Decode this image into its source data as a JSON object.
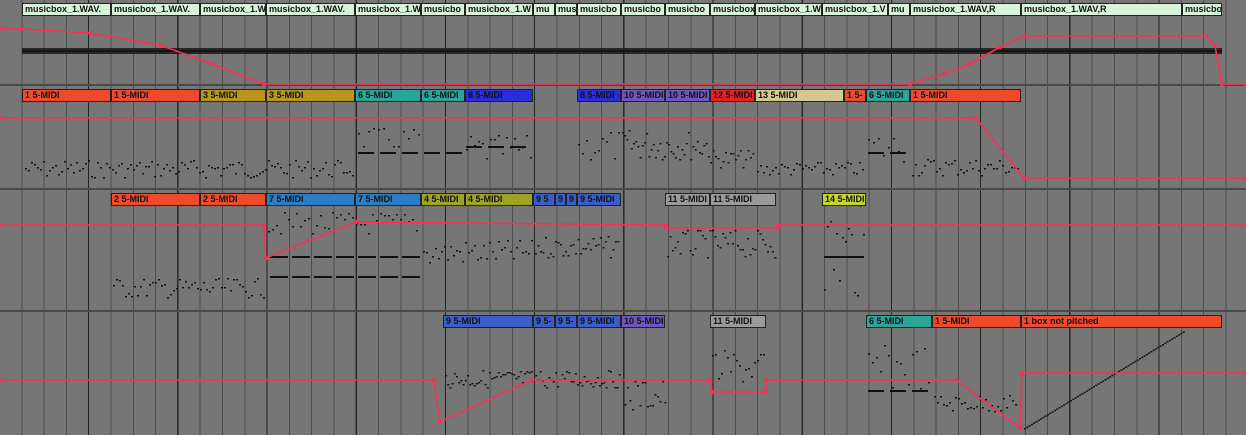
{
  "colors": {
    "automation": "#ff2d55",
    "background": "#767676",
    "note": "#111111"
  },
  "audio_clips": [
    {
      "label": "musicbox_1.WAV.",
      "color": "#d8f3d8"
    },
    {
      "label": "musicbox_1.WAV.",
      "color": "#d8f3d8"
    },
    {
      "label": "musicbox_1.W",
      "color": "#d8f3d8"
    },
    {
      "label": "musicbox_1.WAV.",
      "color": "#d8f3d8"
    },
    {
      "label": "musicbox_1.W",
      "color": "#d8f3d8"
    },
    {
      "label": "musicbo",
      "color": "#d8f3d8"
    },
    {
      "label": "musicbox_1.W",
      "color": "#d8f3d8"
    },
    {
      "label": "mu",
      "color": "#d8f3d8"
    },
    {
      "label": "mus",
      "color": "#d8f3d8"
    },
    {
      "label": "musicbo",
      "color": "#d8f3d8"
    },
    {
      "label": "musicbo",
      "color": "#d8f3d8"
    },
    {
      "label": "musicbo",
      "color": "#d8f3d8"
    },
    {
      "label": "musicbox_1.V",
      "color": "#d8f3d8"
    },
    {
      "label": "musicbox_1.W",
      "color": "#d8f3d8"
    },
    {
      "label": "musicbox_1.V",
      "color": "#d8f3d8"
    },
    {
      "label": "mu",
      "color": "#d8f3d8"
    },
    {
      "label": "musicbox_1.WAV,R",
      "color": "#d8f3d8"
    },
    {
      "label": "musicbox_1.WAV,R",
      "color": "#d8f3d8"
    },
    {
      "label": "musicbo",
      "color": "#d8f3d8"
    }
  ],
  "lane1_clips": [
    {
      "label": "1 5-MIDI",
      "color": "#f04a2a"
    },
    {
      "label": "1 5-MIDI",
      "color": "#f04a2a"
    },
    {
      "label": "3 5-MIDI",
      "color": "#b8961c"
    },
    {
      "label": "3 5-MIDI",
      "color": "#b8961c"
    },
    {
      "label": "6 5-MIDI",
      "color": "#2aa59a"
    },
    {
      "label": "6 5-MIDI",
      "color": "#2aa59a"
    },
    {
      "label": "8 5-MIDI",
      "color": "#2b2bdc"
    },
    {
      "label": "8 5-MIDI",
      "color": "#2b2bdc"
    },
    {
      "label": "10 5-MIDI",
      "color": "#6e56c2"
    },
    {
      "label": "10 5-MIDI",
      "color": "#6e56c2"
    },
    {
      "label": "12 5-MIDI",
      "color": "#ee1e1e"
    },
    {
      "label": "13 5-MIDI",
      "color": "#d4c88e"
    },
    {
      "label": "1 5-",
      "color": "#f04a2a"
    },
    {
      "label": "6 5-MIDI",
      "color": "#2aa59a"
    },
    {
      "label": "1 5-MIDI",
      "color": "#f04a2a"
    }
  ],
  "lane2_clips": [
    {
      "label": "2 5-MIDI",
      "color": "#f04a2a"
    },
    {
      "label": "2 5-MIDI",
      "color": "#f04a2a"
    },
    {
      "label": "7 5-MIDI",
      "color": "#2a7fc4"
    },
    {
      "label": "7 5-MIDI",
      "color": "#2a7fc4"
    },
    {
      "label": "4 5-MIDI",
      "color": "#9ca325"
    },
    {
      "label": "4 5-MIDI",
      "color": "#9ca325"
    },
    {
      "label": "9 5",
      "color": "#3a5ec9"
    },
    {
      "label": "9 5",
      "color": "#3a5ec9"
    },
    {
      "label": "9 5-",
      "color": "#3a5ec9"
    },
    {
      "label": "9 5-MIDI",
      "color": "#3a5ec9"
    },
    {
      "label": "11 5-MIDI",
      "color": "#9a9a9a"
    },
    {
      "label": "11 5-MIDI",
      "color": "#9a9a9a"
    },
    {
      "label": "14 5-MIDI",
      "color": "#c8d62a"
    }
  ],
  "lane3_clips": [
    {
      "label": "9 5-MIDI",
      "color": "#3a5ec9"
    },
    {
      "label": "9 5-",
      "color": "#3a5ec9"
    },
    {
      "label": "9 5-",
      "color": "#3a5ec9"
    },
    {
      "label": "9 5-MIDI",
      "color": "#3a5ec9"
    },
    {
      "label": "10 5-MIDI",
      "color": "#6e56c2"
    },
    {
      "label": "11 5-MIDI",
      "color": "#9a9a9a"
    },
    {
      "label": "6 5-MIDI",
      "color": "#2aa59a"
    },
    {
      "label": "1 5-MIDI",
      "color": "#f04a2a"
    },
    {
      "label": "1 box not pitched",
      "color": "#f04a2a"
    }
  ]
}
